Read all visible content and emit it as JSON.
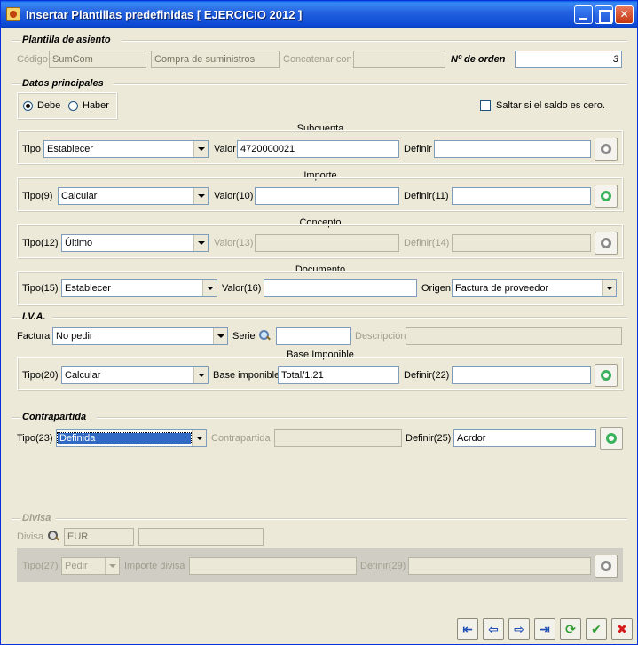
{
  "window": {
    "title": "Insertar Plantillas predefinidas [ EJERCICIO 2012 ]"
  },
  "plantilla": {
    "section_title": "Plantilla de asiento",
    "codigo_label": "Código",
    "codigo_value": "SumCom",
    "descripcion_value": "Compra de suministros",
    "concatenar_label": "Concatenar con",
    "concatenar_value": "",
    "orden_label": "Nº de orden",
    "orden_value": "3"
  },
  "datos": {
    "section_title": "Datos principales",
    "debe_label": "Debe",
    "haber_label": "Haber",
    "saltar_label": "Saltar si el saldo es cero.",
    "subcuenta": {
      "title": "Subcuenta",
      "tipo_label": "Tipo",
      "tipo_value": "Establecer",
      "valor_label": "Valor",
      "valor_value": "4720000021",
      "definir_label": "Definir",
      "definir_value": ""
    },
    "importe": {
      "title": "Importe",
      "tipo_label": "Tipo(9)",
      "tipo_value": "Calcular",
      "valor_label": "Valor(10)",
      "valor_value": "",
      "definir_label": "Definir(11)",
      "definir_value": ""
    },
    "concepto": {
      "title": "Concepto",
      "tipo_label": "Tipo(12)",
      "tipo_value": "Último",
      "valor_label": "Valor(13)",
      "valor_value": "",
      "definir_label": "Definir(14)",
      "definir_value": ""
    },
    "documento": {
      "title": "Documento",
      "tipo_label": "Tipo(15)",
      "tipo_value": "Establecer",
      "valor_label": "Valor(16)",
      "valor_value": "",
      "origen_label": "Origen",
      "origen_value": "Factura de proveedor"
    }
  },
  "iva": {
    "section_title": "I.V.A.",
    "factura_label": "Factura",
    "factura_value": "No pedir",
    "serie_label": "Serie",
    "serie_value": "",
    "descripcion_label": "Descripción",
    "descripcion_value": "",
    "base": {
      "title": "Base Imponible",
      "tipo_label": "Tipo(20)",
      "tipo_value": "Calcular",
      "base_label": "Base imponible",
      "base_value": "Total/1.21",
      "definir_label": "Definir(22)",
      "definir_value": ""
    }
  },
  "contrapartida": {
    "section_title": "Contrapartida",
    "tipo_label": "Tipo(23)",
    "tipo_value": "Definida",
    "contrapartida_label": "Contrapartida",
    "contrapartida_value": "",
    "definir_label": "Definir(25)",
    "definir_value": "Acrdor"
  },
  "divisa": {
    "section_title": "Divisa",
    "divisa_label": "Divisa",
    "divisa_value": "EUR",
    "divisa_desc": "",
    "tipo_label": "Tipo(27)",
    "tipo_value": "Pedir",
    "importe_label": "Importe divisa",
    "importe_value": "",
    "definir_label": "Definir(29)",
    "definir_value": ""
  },
  "nav": {
    "first": "⇤",
    "prev": "⇦",
    "next": "⇨",
    "last": "⇥",
    "refresh": "⟳",
    "accept": "✔",
    "cancel": "✖"
  }
}
